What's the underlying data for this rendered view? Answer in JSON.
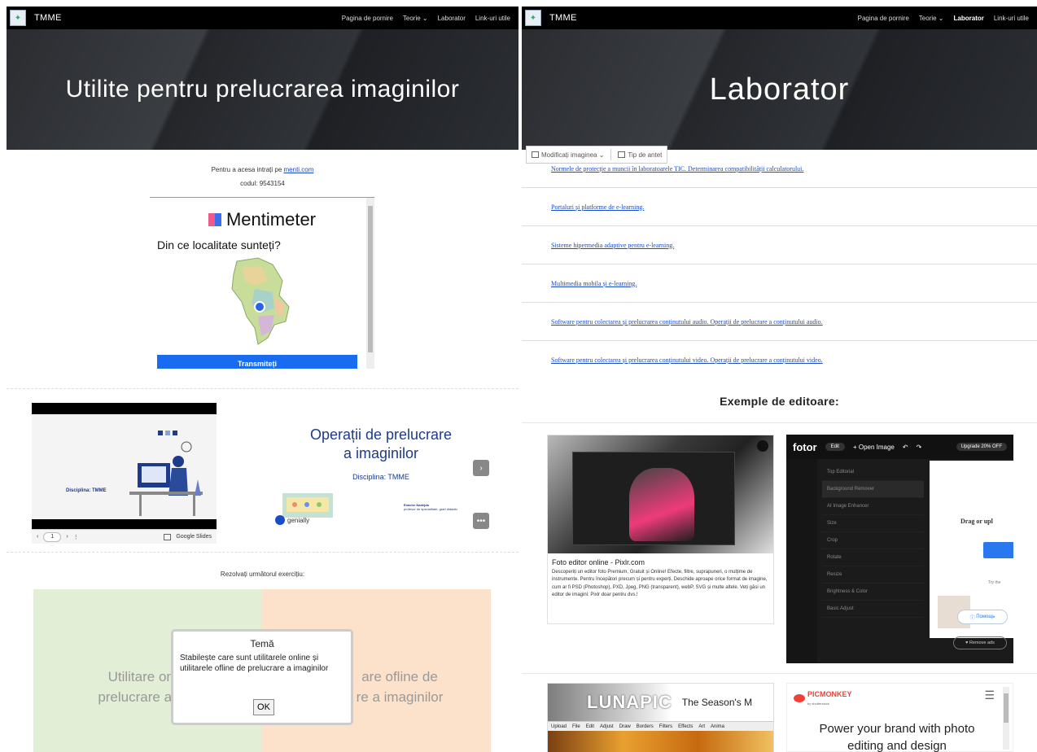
{
  "site": {
    "brand": "TMME",
    "nav": [
      "Pagina de pornire",
      "Teorie ⌄",
      "Laborator",
      "Link-uri utile"
    ]
  },
  "tl": {
    "hero_title": "Utilite pentru prelucrarea imaginilor",
    "access_text": "Pentru a acesa intrați pe ",
    "access_link": "menti.com",
    "code": "codul: 9543154",
    "menti_brand": "Mentimeter",
    "question": "Din ce localitate sunteți?",
    "submit": "Transmiteți"
  },
  "tr": {
    "hero_title": "Laborator",
    "edit_image": "Modificați imaginea ⌄",
    "header_type": "Tip de antet",
    "links": [
      "Normele de protecție a muncii în laboratoarele TIC. Determinarea compatibilității calculatorului.",
      "Portaluri și platforme de e-learning.",
      "Sisteme hipermedia adaptive pentru e-learning.",
      "Multimedia mobila și e-learning.",
      "Software pentru colectarea și prelucrarea conținutului audio. Operații de prelucrare a conținutului audio.",
      "Software pentru colectarea și prelucrarea conținutului video. Operații de prelucrare a conținutului video."
    ]
  },
  "bl": {
    "slide_discipline": "Disciplina: TMME",
    "slide_page": "1",
    "slides_brand": "Google Slides",
    "genially_title_1": "Operații de prelucrare",
    "genially_title_2": "a imaginilor",
    "genially_discipline": "Disciplina: TMME",
    "genially_brand": "genially",
    "genially_author": "Enache Nadejda",
    "genially_author_role": "profesor de specialitate, grad didactic",
    "resolve": "Rezolvați următorul exercițiu:",
    "ex_left_1": "Utilitare onli",
    "ex_left_2": "prelucrare a im",
    "ex_right_1": "are ofline de",
    "ex_right_2": "re a imaginilor",
    "modal_title": "Temă",
    "modal_text": "Stabilește care sunt utilitarele online și utilitarele ofline de prelucrare a imaginilor",
    "modal_ok": "OK"
  },
  "br": {
    "title": "Exemple de editoare:",
    "pixlr_title": "Foto editor online - Pixlr.com",
    "pixlr_desc": "Descoperiți un editor foto Premium, Gratuit și Online! Efecte, filtre, suprapuneri, o mulțime de instrumente. Pentru începători precum și pentru experți. Deschide aproape orice format de imagine, cum ar fi PSD (Photoshop), PXD, Jpeg, PNG (transparent), webP, SVG și multe altele. Veți găsi un editor de imagini: Pixlr doar pentru dvs.!",
    "fotor_brand": "fotor",
    "fotor_edit": "Edit",
    "fotor_open": "+ Open Image",
    "fotor_upgrade": "Upgrade 20% OFF",
    "fotor_menu": [
      "Top Editorial",
      "Background Remover",
      "AI Image Enhancer",
      "Size",
      "Crop",
      "Rotate",
      "Resize",
      "Brightness & Color",
      "Basic Adjust"
    ],
    "fotor_drag": "Drag or upl",
    "fotor_try": "Try the",
    "fotor_help": "Помощь",
    "fotor_remove_ads": "Remove ads",
    "luna_brand": "LUNAPIC",
    "luna_season": "The Season's M",
    "luna_menu": [
      "Upload",
      "File",
      "Edit",
      "Adjust",
      "Draw",
      "Borders",
      "Filters",
      "Effects",
      "Art",
      "Anima"
    ],
    "pm_brand": "PICMONKEY",
    "pm_sub": "by shutterstock",
    "pm_text": "Power your brand with photo editing and design"
  }
}
